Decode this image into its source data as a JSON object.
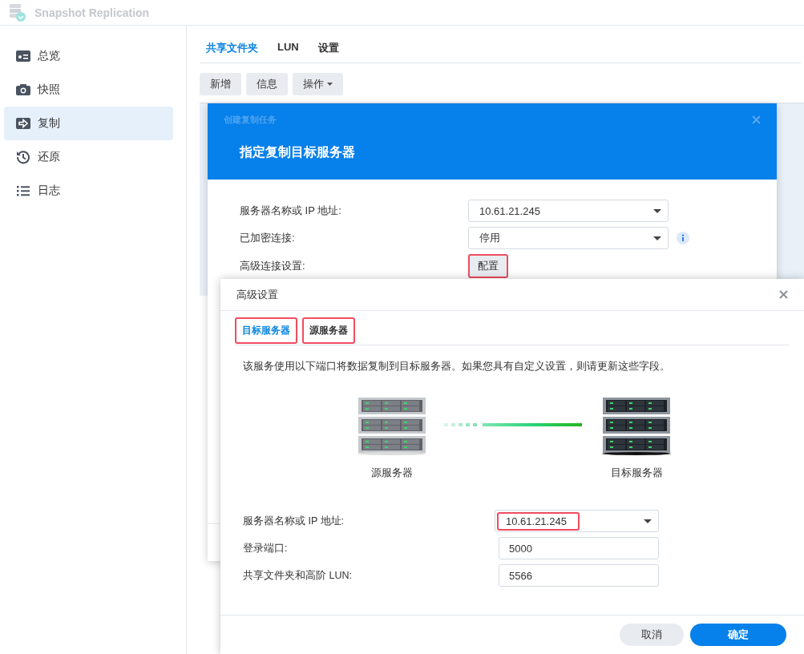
{
  "app": {
    "title": "Snapshot Replication"
  },
  "sidebar": {
    "items": [
      {
        "label": "总览",
        "selected": false
      },
      {
        "label": "快照",
        "selected": false
      },
      {
        "label": "复制",
        "selected": true
      },
      {
        "label": "还原",
        "selected": false
      },
      {
        "label": "日志",
        "selected": false
      }
    ]
  },
  "tabs": [
    {
      "label": "共享文件夹",
      "selected": true
    },
    {
      "label": "LUN",
      "selected": false
    },
    {
      "label": "设置",
      "selected": false
    }
  ],
  "toolbar": [
    {
      "label": "新增",
      "kind": "button"
    },
    {
      "label": "信息",
      "kind": "button"
    },
    {
      "label": "操作",
      "kind": "menu"
    }
  ],
  "wizard": {
    "caption": "创建复制任务",
    "heading": "指定复制目标服务器",
    "fields": [
      {
        "label": "服务器名称或 IP 地址:",
        "kind": "select",
        "value": "10.61.21.245",
        "info": false,
        "highlighted": false
      },
      {
        "label": "已加密连接:",
        "kind": "select",
        "value": "停用",
        "info": true,
        "highlighted": false
      },
      {
        "label": "高级连接设置:",
        "kind": "button",
        "value": "配置",
        "info": false,
        "highlighted": true
      }
    ]
  },
  "advanced_dialog": {
    "title": "高级设置",
    "tabs": [
      {
        "label": "目标服务器",
        "selected": true,
        "highlighted": true
      },
      {
        "label": "源服务器",
        "selected": false,
        "highlighted": true
      }
    ],
    "description": "该服务使用以下端口将数据复制到目标服务器。如果您具有自定义设置，则请更新这些字段。",
    "diagram": {
      "source_label": "源服务器",
      "target_label": "目标服务器"
    },
    "fields": [
      {
        "label": "服务器名称或 IP 地址:",
        "kind": "select",
        "value": "10.61.21.245",
        "highlighted": true
      },
      {
        "label": "登录端口:",
        "kind": "text",
        "value": "5000",
        "highlighted": false
      },
      {
        "label": "共享文件夹和高阶 LUN:",
        "kind": "text",
        "value": "5566",
        "highlighted": false
      }
    ],
    "buttons": [
      {
        "label": "取消",
        "kind": "secondary"
      },
      {
        "label": "确定",
        "kind": "primary"
      }
    ]
  }
}
